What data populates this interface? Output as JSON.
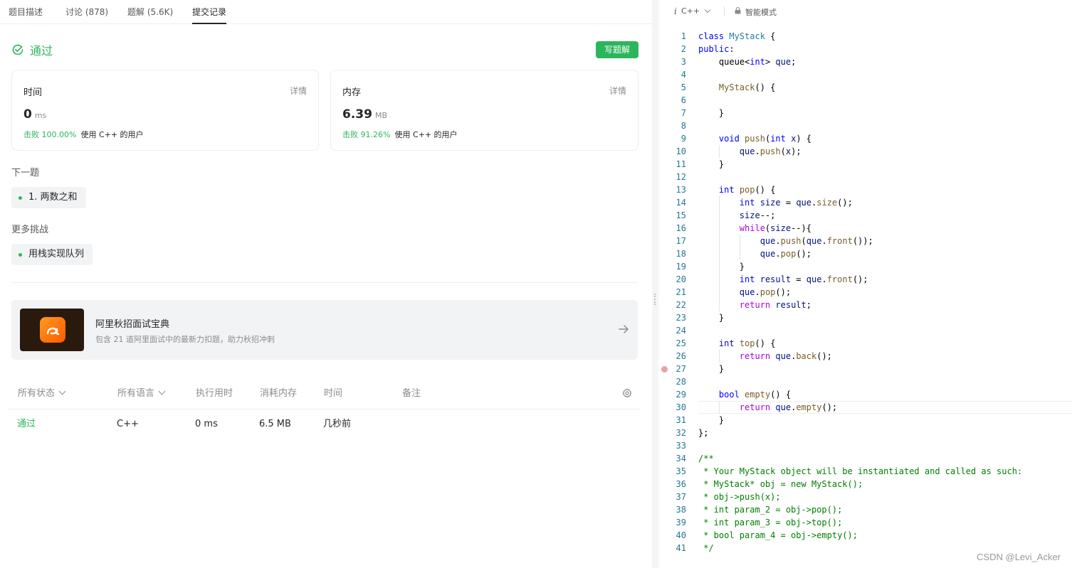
{
  "tabs": [
    {
      "label": "题目描述",
      "active": false
    },
    {
      "label": "讨论 (878)",
      "active": false
    },
    {
      "label": "题解 (5.6K)",
      "active": false
    },
    {
      "label": "提交记录",
      "active": true
    }
  ],
  "result": {
    "status": "通过",
    "write_solution_button": "写题解",
    "time_card": {
      "label": "时间",
      "detail": "详情",
      "value": "0",
      "unit": "ms",
      "beat_pct": "击败 100.00%",
      "beat_suffix": "使用 C++ 的用户"
    },
    "memory_card": {
      "label": "内存",
      "detail": "详情",
      "value": "6.39",
      "unit": "MB",
      "beat_pct": "击败 91.26%",
      "beat_suffix": "使用 C++ 的用户"
    }
  },
  "next_problem": {
    "title": "下一题",
    "item": "1. 两数之和"
  },
  "more_challenges": {
    "title": "更多挑战",
    "item": "用栈实现队列"
  },
  "promo": {
    "title": "阿里秋招面试宝典",
    "subtitle": "包含 21 道阿里面试中的最新力扣题，助力秋招冲刺"
  },
  "submissions": {
    "headers": {
      "status": "所有状态",
      "language": "所有语言",
      "runtime": "执行用时",
      "memory": "消耗内存",
      "time": "时间",
      "note": "备注"
    },
    "rows": [
      {
        "status": "通过",
        "language": "C++",
        "runtime": "0 ms",
        "memory": "6.5 MB",
        "time": "几秒前",
        "note": ""
      }
    ]
  },
  "editor": {
    "language": "C++",
    "mode": "智能模式",
    "active_line": 30,
    "breakpoint_line": 27,
    "lines": [
      "class MyStack {",
      "public:",
      "    queue<int> que;",
      "",
      "    MyStack() {",
      "",
      "    }",
      "",
      "    void push(int x) {",
      "        que.push(x);",
      "    }",
      "",
      "    int pop() {",
      "        int size = que.size();",
      "        size--;",
      "        while(size--){",
      "            que.push(que.front());",
      "            que.pop();",
      "        }",
      "        int result = que.front();",
      "        que.pop();",
      "        return result;",
      "    }",
      "",
      "    int top() {",
      "        return que.back();",
      "    }",
      "",
      "    bool empty() {",
      "        return que.empty();",
      "    }",
      "};",
      "",
      "/**",
      " * Your MyStack object will be instantiated and called as such:",
      " * MyStack* obj = new MyStack();",
      " * obj->push(x);",
      " * int param_2 = obj->pop();",
      " * int param_3 = obj->top();",
      " * bool param_4 = obj->empty();",
      " */"
    ]
  },
  "watermark": "CSDN @Levi_Acker",
  "colors": {
    "accent": "#2db55d",
    "chip_bg": "#f2f3f5",
    "line_number": "#237893"
  }
}
